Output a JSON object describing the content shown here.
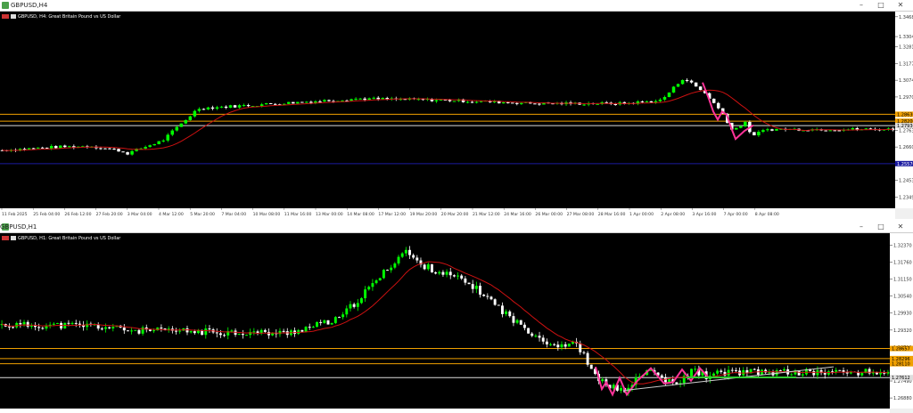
{
  "window_top": {
    "title": "GBPUSD,H4",
    "symbol_label": "GBPUSD, H4:  Great Britain Pound vs US Dollar",
    "price_ticks": [
      "1.34680",
      "1.33045",
      "1.32810",
      "1.31775",
      "1.30740",
      "1.29705",
      "1.28670",
      "1.27635",
      "1.26600",
      "1.25565",
      "1.24530",
      "1.23495"
    ],
    "price_tick_values": [
      1.3468,
      1.3345,
      1.3281,
      1.31775,
      1.3074,
      1.29705,
      1.2867,
      1.27635,
      1.266,
      1.25565,
      1.2453,
      1.23495
    ],
    "price_labels": [
      {
        "text": "1.28630",
        "value": 1.2863,
        "color": "#f0a000"
      },
      {
        "text": "1.28200",
        "value": 1.282,
        "color": "#f0a000"
      },
      {
        "text": "1.27930",
        "value": 1.2793,
        "color": "#dddddd"
      },
      {
        "text": "1.25570",
        "value": 1.2557,
        "color": "#1a1aa0"
      }
    ],
    "time_ticks": [
      "11 Feb 2025",
      "25 Feb 04:00",
      "26 Feb 12:00",
      "27 Feb 20:00",
      "3 Mar 04:00",
      "4 Mar 12:00",
      "5 Mar 20:00",
      "7 Mar 04:00",
      "10 Mar 08:00",
      "11 Mar 16:00",
      "13 Mar 00:00",
      "14 Mar 08:00",
      "17 Mar 12:00",
      "19 Mar 20:00",
      "20 Mar 20:00",
      "21 Mar 12:00",
      "24 Mar 16:00",
      "26 Mar 00:00",
      "27 Mar 08:00",
      "28 Mar 16:00",
      "1 Apr 00:00",
      "2 Apr 08:00",
      "3 Apr 16:00",
      "7 Apr 00:00",
      "8 Apr 08:00"
    ],
    "scale": {
      "min": 1.228,
      "max": 1.35
    }
  },
  "window_bottom": {
    "title": "GBPUSD,H1",
    "symbol_label": "GBPUSD, H1:  Great Britain Pound vs US Dollar",
    "price_ticks": [
      "1.32370",
      "1.31760",
      "1.31150",
      "1.30540",
      "1.29930",
      "1.29320",
      "1.28710",
      "1.28100",
      "1.27490",
      "1.26880"
    ],
    "price_tick_values": [
      1.3237,
      1.3176,
      1.3115,
      1.3054,
      1.2993,
      1.2932,
      1.2871,
      1.281,
      1.2749,
      1.2688
    ],
    "price_labels": [
      {
        "text": "1.28657",
        "value": 1.28657,
        "color": "#f0a000"
      },
      {
        "text": "1.28296",
        "value": 1.28296,
        "color": "#f0a000"
      },
      {
        "text": "1.28110",
        "value": 1.2811,
        "color": "#f0a000"
      },
      {
        "text": "1.27612",
        "value": 1.27612,
        "color": "#dddddd"
      }
    ],
    "time_ticks": [
      "",
      "",
      "",
      "",
      "",
      "",
      "",
      "",
      "",
      "",
      "",
      "",
      "",
      "",
      "",
      "",
      "",
      "",
      "",
      "",
      "",
      "",
      "",
      "",
      ""
    ],
    "scale": {
      "min": 1.265,
      "max": 1.328
    }
  },
  "icons": {
    "minimize": "minimize-icon",
    "maximize": "maximize-icon",
    "close": "close-icon",
    "app": "chart-app-icon"
  },
  "colors": {
    "bull": "#00ff00",
    "bear": "#ffffff",
    "ma": "#cc1111",
    "level": "#f0a000",
    "blue_level": "#1a1aa0",
    "zigzag": "#ff3399",
    "trend": "#cccccc",
    "support": "#33cc33"
  }
}
